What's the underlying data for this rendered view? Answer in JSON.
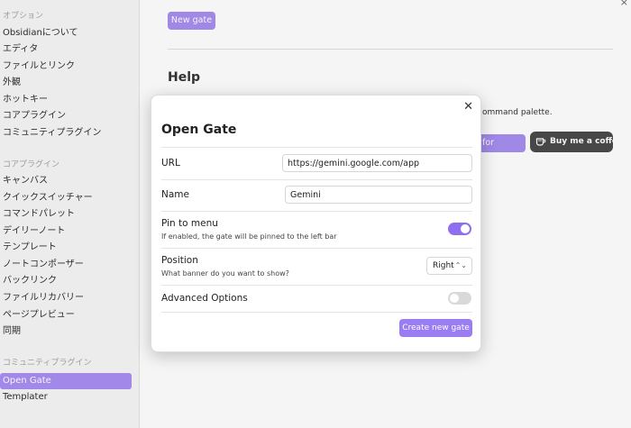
{
  "sidebar": {
    "sections": [
      {
        "heading": "オプション",
        "items": [
          "Obsidianについて",
          "エディタ",
          "ファイルとリンク",
          "外観",
          "ホットキー",
          "コアプラグイン",
          "コミュニティプラグイン"
        ]
      },
      {
        "heading": "コアプラグイン",
        "items": [
          "キャンバス",
          "クイックスイッチャー",
          "コマンドパレット",
          "デイリーノート",
          "テンプレート",
          "ノートコンポーザー",
          "バックリンク",
          "ファイルリカバリー",
          "ページプレビュー",
          "同期"
        ]
      },
      {
        "heading": "コミュニティプラグイン",
        "items": [
          "Open Gate",
          "Templater"
        ],
        "active_item": "Open Gate"
      }
    ]
  },
  "main": {
    "new_gate_label": "New gate",
    "help_title": "Help",
    "help_text_partial": "ommand palette.",
    "update_label_partial": "for update",
    "coffee_label": "Buy me a coffee",
    "close_glyph": "×"
  },
  "modal": {
    "title": "Open Gate",
    "close_glyph": "✕",
    "url_label": "URL",
    "url_value": "https://gemini.google.com/app",
    "name_label": "Name",
    "name_value": "Gemini",
    "pin_label": "Pin to menu",
    "pin_desc": "If enabled, the gate will be pinned to the left bar",
    "pin_enabled": true,
    "position_label": "Position",
    "position_desc": "What banner do you want to show?",
    "position_value": "Right",
    "advanced_label": "Advanced Options",
    "advanced_enabled": false,
    "create_label": "Create new gate"
  },
  "colors": {
    "accent": "#a98ef2",
    "sidebar_bg": "#f6f6f6",
    "coffee_bg": "#4a4a4a"
  }
}
